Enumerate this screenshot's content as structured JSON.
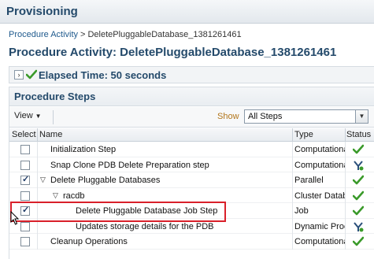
{
  "header": {
    "title": "Provisioning"
  },
  "breadcrumb": {
    "parent": "Procedure Activity",
    "separator": ">",
    "current": "DeletePluggableDatabase_1381261461"
  },
  "page": {
    "title": "Procedure Activity: DeletePluggableDatabase_1381261461"
  },
  "elapsed": {
    "expand_glyph": "›",
    "text": "Elapsed Time: 50 seconds"
  },
  "steps": {
    "title": "Procedure Steps",
    "toolbar": {
      "view_label": "View",
      "show_label": "Show",
      "show_value": "All Steps"
    },
    "columns": {
      "select": "Select",
      "name": "Name",
      "type": "Type",
      "status": "Status"
    },
    "rows": [
      {
        "name": "Initialization Step",
        "type": "Computational",
        "checked": false,
        "status": "success"
      },
      {
        "name": "Snap Clone PDB Delete Preparation step",
        "type": "Computational",
        "checked": false,
        "status": "running"
      },
      {
        "name": "Delete Pluggable Databases",
        "type": "Parallel",
        "checked": true,
        "status": "success",
        "toggle": "▽"
      },
      {
        "name": "racdb",
        "type": "Cluster Database",
        "checked": false,
        "status": "success",
        "toggle": "▽"
      },
      {
        "name": "Delete Pluggable Database Job Step",
        "type": "Job",
        "checked": true,
        "status": "success"
      },
      {
        "name": "Updates storage details for the PDB",
        "type": "Dynamic Procedure",
        "checked": false,
        "status": "running"
      },
      {
        "name": "Cleanup Operations",
        "type": "Computational",
        "checked": false,
        "status": "success"
      }
    ]
  },
  "colors": {
    "accent": "#244a6b",
    "highlight": "#d9202a",
    "success": "#3a9a2a"
  }
}
